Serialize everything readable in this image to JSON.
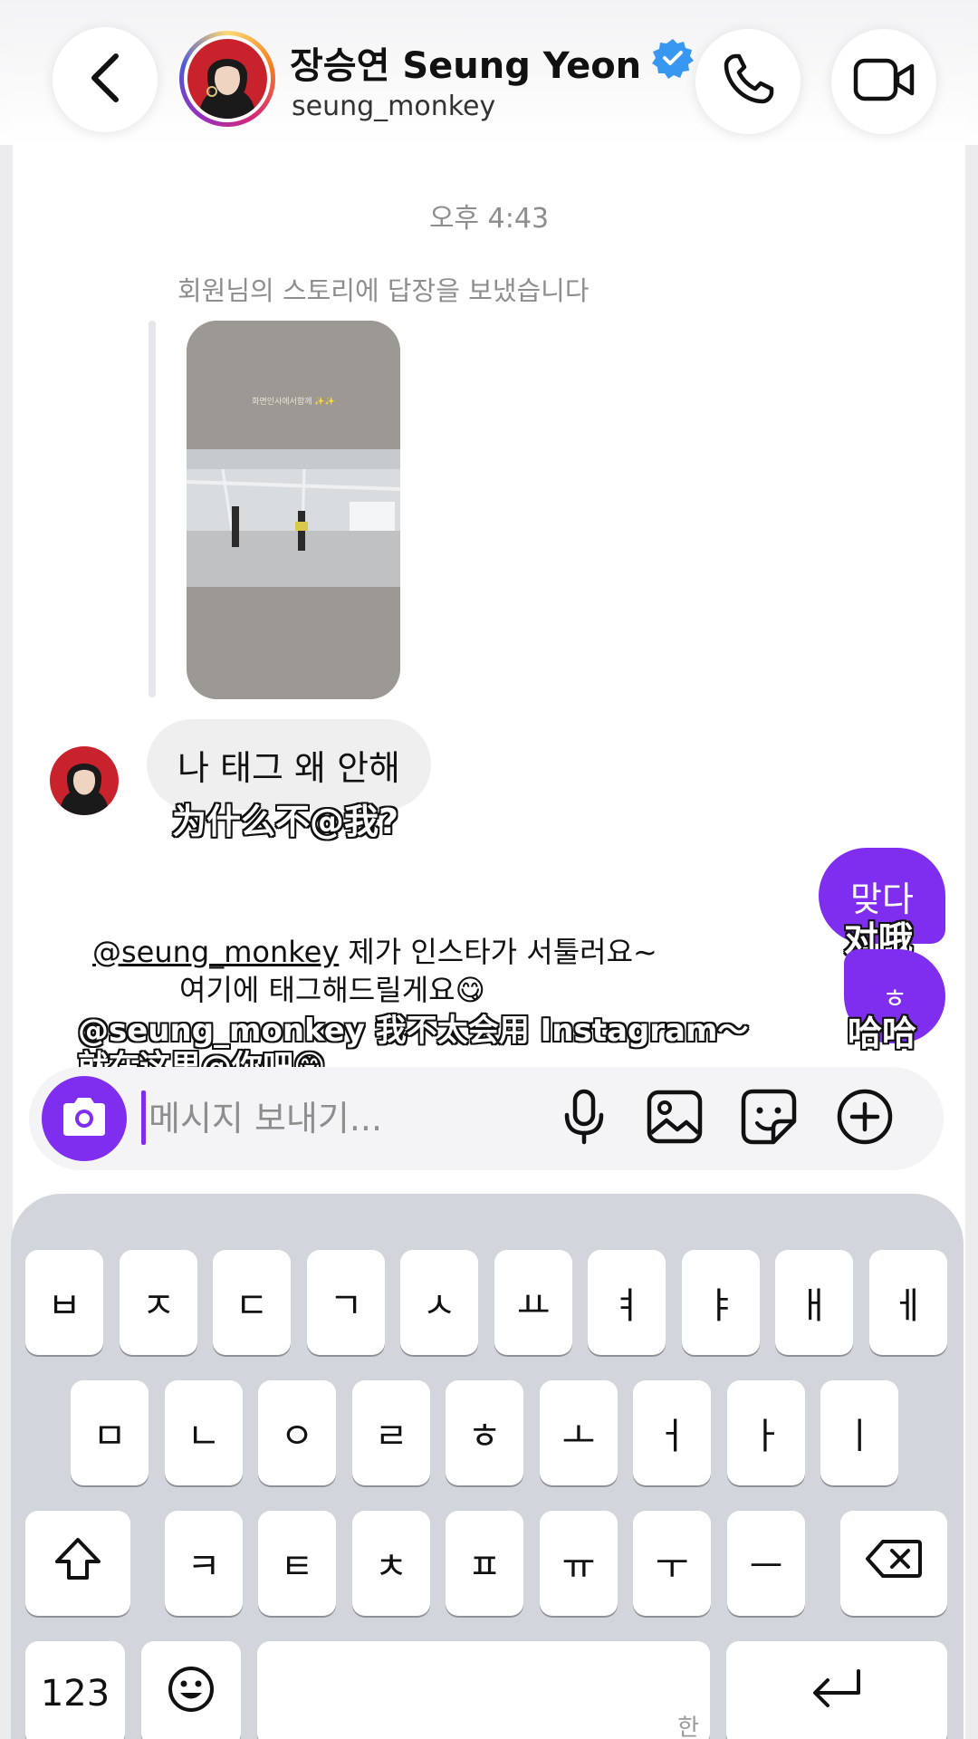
{
  "colors": {
    "accent": "#7f2ef0",
    "verified": "#3897f0",
    "bubble_received": "#efefef",
    "keyboard_bg": "#d3d5dc"
  },
  "header": {
    "display_name": "장승연 Seung Yeon",
    "username": "seung_monkey",
    "icons": [
      "back-icon",
      "verified-badge-icon",
      "phone-icon",
      "video-call-icon"
    ]
  },
  "chat": {
    "timestamp": "오후 4:43",
    "story_reply_note": "회원님의 스토리에 답장을 보냈습니다",
    "story_caption": "화면인사에서함께 ✨✨",
    "received_message": {
      "text": "나 태그 왜 안해",
      "subtitle": "为什么不@我?"
    },
    "sent_messages": [
      {
        "text": "맞다",
        "subtitle": "对哦"
      },
      {
        "text": "ㅎ",
        "subtitle": "哈哈"
      }
    ],
    "caption": {
      "mention": "@seung_monkey",
      "line1_rest": "제가 인스타가 서툴러요~",
      "line2": "여기에 태그해드릴게요😋",
      "zh_line1": "@seung_monkey 我不太会用 Instagram～",
      "zh_line2": "就在这里@你吧😋"
    }
  },
  "composer": {
    "placeholder": "메시지 보내기...",
    "icons": [
      "camera-icon",
      "microphone-icon",
      "gallery-icon",
      "sticker-icon",
      "plus-icon"
    ]
  },
  "keyboard": {
    "row1": [
      "ㅂ",
      "ㅈ",
      "ㄷ",
      "ㄱ",
      "ㅅ",
      "ㅛ",
      "ㅕ",
      "ㅑ",
      "ㅐ",
      "ㅔ"
    ],
    "row2": [
      "ㅁ",
      "ㄴ",
      "ㅇ",
      "ㄹ",
      "ㅎ",
      "ㅗ",
      "ㅓ",
      "ㅏ",
      "ㅣ"
    ],
    "row3": [
      "ㅋ",
      "ㅌ",
      "ㅊ",
      "ㅍ",
      "ㅠ",
      "ㅜ",
      "ㅡ"
    ],
    "numbers_label": "123",
    "space_hint": "한"
  }
}
